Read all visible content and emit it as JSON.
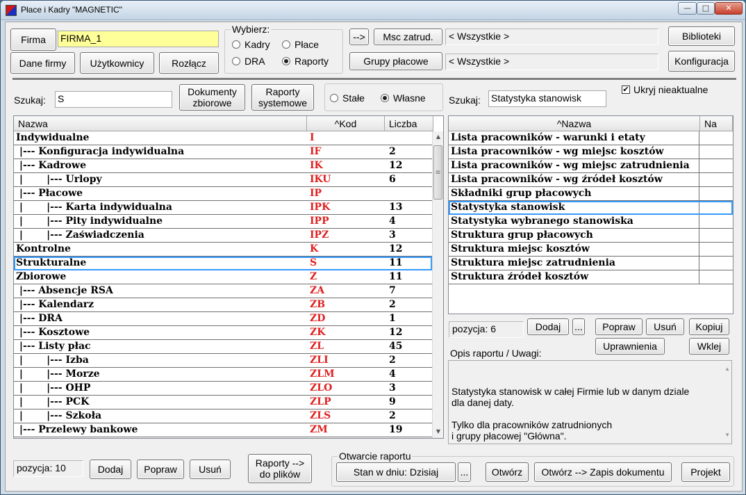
{
  "window": {
    "title": "Płace i Kadry \"MAGNETIC\"",
    "controls": {
      "minimize": "—",
      "maximize": "□",
      "close": "✕"
    }
  },
  "top": {
    "firma_button": "Firma",
    "firma_value": "FIRMA_1",
    "dane_firmy": "Dane firmy",
    "uzytkownicy": "Użytkownicy",
    "rozlacz": "Rozłącz",
    "wybierz": {
      "title": "Wybierz:",
      "kadry": "Kadry",
      "place": "Płace",
      "dra": "DRA",
      "raporty": "Raporty",
      "selected": "Raporty"
    },
    "arrow_button": "-->",
    "msc_zatrud": "Msc zatrud.",
    "grupy_placowe": "Grupy płacowe",
    "msc_value": "< Wszystkie >",
    "grupy_value": "< Wszystkie >",
    "biblioteki": "Biblioteki",
    "konfiguracja": "Konfiguracja"
  },
  "search_left": {
    "label": "Szukaj:",
    "value": "S",
    "dokumenty_zbiorowe": "Dokumenty\nzbiorowe",
    "raporty_systemowe": "Raporty\nsystemowe",
    "stale": "Stałe",
    "wlasne": "Własne",
    "selected": "Własne"
  },
  "search_right": {
    "label": "Szukaj:",
    "value": "Statystyka stanowisk",
    "ukryj_label": "Ukryj nieaktualne",
    "ukryj_checked": true,
    "check_glyph": "✔"
  },
  "left_grid": {
    "headers": {
      "nazwa": "Nazwa",
      "kod": "^Kod",
      "liczba": "Liczba"
    },
    "selected_index": 9,
    "rows": [
      {
        "name": "Indywidualne",
        "kod": "I",
        "count": ""
      },
      {
        "name": " |--- Konfiguracja indywidualna",
        "kod": "IF",
        "count": "2"
      },
      {
        "name": " |--- Kadrowe",
        "kod": "IK",
        "count": "12"
      },
      {
        "name": " |       |--- Urlopy",
        "kod": "IKU",
        "count": "6"
      },
      {
        "name": " |--- Płacowe",
        "kod": "IP",
        "count": ""
      },
      {
        "name": " |       |--- Karta indywidualna",
        "kod": "IPK",
        "count": "13"
      },
      {
        "name": " |       |--- Pity indywidualne",
        "kod": "IPP",
        "count": "4"
      },
      {
        "name": " |       |--- Zaświadczenia",
        "kod": "IPZ",
        "count": "3"
      },
      {
        "name": "Kontrolne",
        "kod": "K",
        "count": "12"
      },
      {
        "name": "Strukturalne",
        "kod": "S",
        "count": "11"
      },
      {
        "name": "Zbiorowe",
        "kod": "Z",
        "count": "11"
      },
      {
        "name": " |--- Absencje RSA",
        "kod": "ZA",
        "count": "7"
      },
      {
        "name": " |--- Kalendarz",
        "kod": "ZB",
        "count": "2"
      },
      {
        "name": " |--- DRA",
        "kod": "ZD",
        "count": "1"
      },
      {
        "name": " |--- Kosztowe",
        "kod": "ZK",
        "count": "12"
      },
      {
        "name": " |--- Listy płac",
        "kod": "ZL",
        "count": "45"
      },
      {
        "name": " |       |--- Izba",
        "kod": "ZLI",
        "count": "2"
      },
      {
        "name": " |       |--- Morze",
        "kod": "ZLM",
        "count": "4"
      },
      {
        "name": " |       |--- OHP",
        "kod": "ZLO",
        "count": "3"
      },
      {
        "name": " |       |--- PCK",
        "kod": "ZLP",
        "count": "9"
      },
      {
        "name": " |       |--- Szkoła",
        "kod": "ZLS",
        "count": "2"
      },
      {
        "name": " |--- Przelewy bankowe",
        "kod": "ZM",
        "count": "19"
      }
    ],
    "scroll_up": "▲",
    "scroll_down": "▼",
    "grip": "≡"
  },
  "right_grid": {
    "headers": {
      "nazwa": "^Nazwa",
      "na": "Na"
    },
    "selected_index": 5,
    "rows": [
      "Lista pracowników - warunki i etaty",
      "Lista pracowników - wg miejsc kosztów",
      "Lista pracowników - wg miejsc zatrudnienia",
      "Lista pracowników - wg źródeł kosztów",
      "Składniki grup płacowych",
      "Statystyka stanowisk",
      "Statystyka wybranego stanowiska",
      "Struktura grup płacowych",
      "Struktura miejsc kosztów",
      "Struktura miejsc zatrudnienia",
      "Struktura źródeł kosztów"
    ]
  },
  "right_actions": {
    "pozycja": "pozycja:  6",
    "dodaj": "Dodaj",
    "dots": "...",
    "popraw": "Popraw",
    "usun": "Usuń",
    "kopiuj": "Kopiuj",
    "uprawnienia": "Uprawnienia",
    "wklej": "Wklej",
    "opis_label": "Opis raportu / Uwagi:",
    "opis_text": "Statystyka stanowisk w całej Firmie lub w danym dziale\ndla danej daty.\n\nTylko dla pracowników zatrudnionych\ni grupy płacowej \"Główna\".",
    "scroll_up": "▲",
    "scroll_down": "▼"
  },
  "bottom": {
    "pozycja": "pozycja:  10",
    "dodaj": "Dodaj",
    "popraw": "Popraw",
    "usun": "Usuń",
    "raporty_do_plikow": "Raporty -->\ndo plików",
    "otwarcie_title": "Otwarcie raportu",
    "stan_w_dniu": "Stan w dniu: Dzisiaj",
    "dots": "...",
    "otworz": "Otwórz",
    "otworz_zapis": "Otwórz --> Zapis dokumentu",
    "projekt": "Projekt"
  }
}
